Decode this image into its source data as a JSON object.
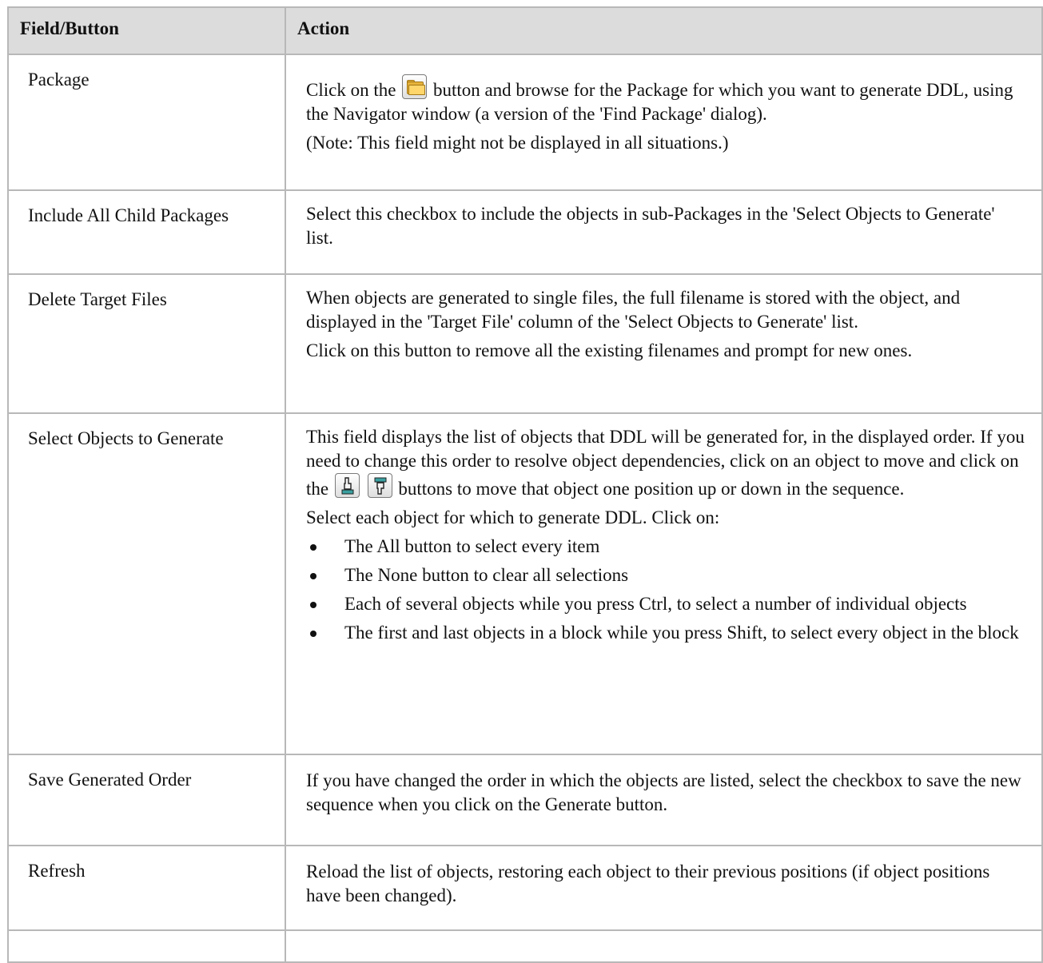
{
  "table": {
    "headers": {
      "field": "Field/Button",
      "action": "Action"
    },
    "rows": [
      {
        "field": "Package",
        "action_pre": "Click on the",
        "action_post": "button and browse for the Package for which you want to generate DDL, using the Navigator window (a version of the 'Find Package' dialog).",
        "note": "(Note: This field might not be displayed in all situations.)",
        "icon": "folder-icon"
      },
      {
        "field": "Include All Child Packages",
        "action": "Select this checkbox to include the objects in sub-Packages in the 'Select Objects to Generate' list."
      },
      {
        "field": "Delete Target Files",
        "action": "When objects are generated to single files, the full filename is stored with the object, and displayed in the 'Target File' column of the 'Select Objects to Generate' list.",
        "action2": "Click on this button to remove all the existing filenames and prompt for new ones."
      },
      {
        "field": "Select Objects to Generate",
        "action_intro": "This field displays the list of objects that DDL will be generated for, in the displayed order. If you need to change this order to resolve object dependencies, click on an object to move and click on the",
        "action_intro_post": "buttons to move that object one position up or down in the sequence.",
        "icons": [
          "move-up-icon",
          "move-down-icon"
        ],
        "select_intro": "Select each object for which to generate DDL. Click on:",
        "bullets": [
          "The All button to select every item",
          "The None button to clear all selections",
          "Each of several objects while you press Ctrl, to select a number of individual objects",
          "The first and last objects in a block while you press Shift, to select every object in the block"
        ]
      },
      {
        "field": "Save Generated Order",
        "action": "If you have changed the order in which the objects are listed, select the checkbox to save the new sequence when you click on the Generate button."
      },
      {
        "field": "Refresh",
        "action": "Reload the list of objects, restoring each object to their previous positions (if object positions have been changed)."
      }
    ]
  }
}
